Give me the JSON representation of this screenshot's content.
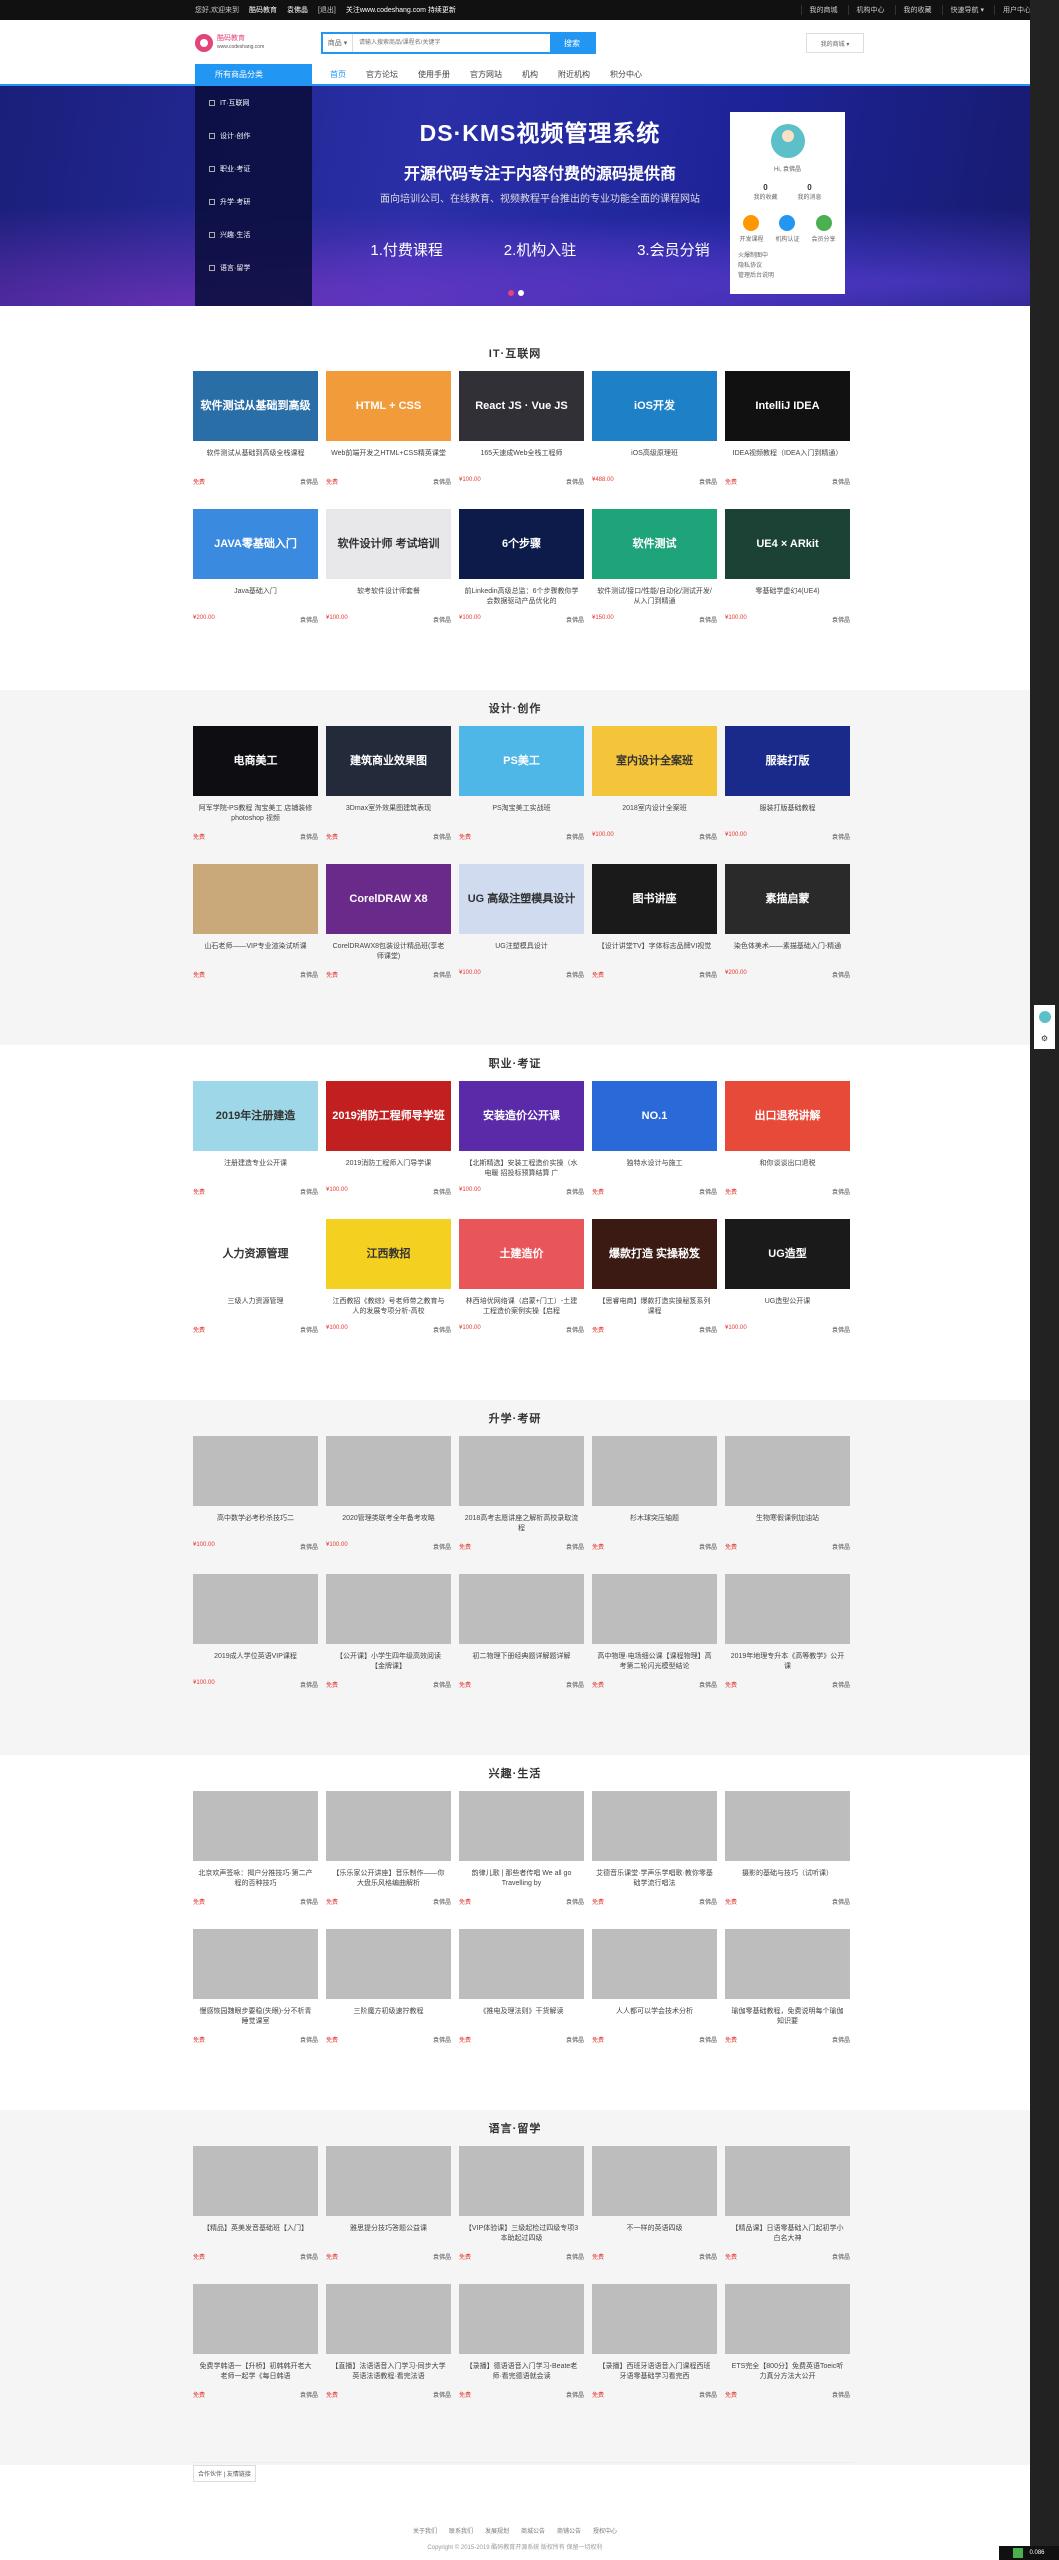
{
  "topbar": {
    "greeting": "您好,欢迎来到",
    "site": "酷码教育",
    "user": "袁佛晶",
    "login": "[退出]",
    "notice": "关注www.codeshang.com 持续更新",
    "right": [
      "我的商城",
      "机构中心",
      "我的收藏",
      "快速导航 ▾",
      "用户中心"
    ]
  },
  "header": {
    "logo_text": "酷码教育",
    "logo_sub": "www.codeshang.com",
    "search_cat": "商品 ▾",
    "search_placeholder": "请输入搜索商品/课程名/关键字",
    "search_button": "搜索",
    "myshop": "我的商城 ▾"
  },
  "nav": {
    "allcat": "所有商品分类",
    "items": [
      "首页",
      "官方论坛",
      "使用手册",
      "官方网站",
      "机构",
      "附近机构",
      "积分中心"
    ]
  },
  "banner": {
    "side": [
      "IT·互联网",
      "设计·创作",
      "职业·考证",
      "升学·考研",
      "兴趣·生活",
      "语言·留学"
    ],
    "title": "DS·KMS视频管理系统",
    "subtitle": "开源代码专注于内容付费的源码提供商",
    "desc": "面向培训公司、在线教育、视频教程平台推出的专业功能全面的课程网站",
    "items": [
      "1.付费课程",
      "2.机构入驻",
      "3.会员分销"
    ],
    "user": {
      "hi": "Hi, 袁佛晶",
      "stats": [
        {
          "n": "0",
          "l": "我的收藏"
        },
        {
          "n": "0",
          "l": "我的消息"
        }
      ],
      "icons": [
        {
          "l": "开发课程",
          "c": "#ff9800"
        },
        {
          "l": "机构认证",
          "c": "#2196f3"
        },
        {
          "l": "会员分享",
          "c": "#4caf50"
        }
      ],
      "links": [
        "火爆制图中",
        "隐私协议",
        "管理后台说明"
      ]
    }
  },
  "sections": [
    {
      "title": "IT·互联网",
      "items": [
        {
          "t": "软件测试从基础到高级全栈课程",
          "p": "免费",
          "s": "袁佛晶",
          "img": "软件测试从基础到高级",
          "c": "#2a6ea8"
        },
        {
          "t": "Web前端开发之HTML+CSS精英课堂",
          "p": "免费",
          "s": "袁佛晶",
          "img": "HTML + CSS",
          "c": "#f29b3a"
        },
        {
          "t": "165天速成Web全栈工程师",
          "p": "¥100.00",
          "s": "袁佛晶",
          "img": "React JS · Vue JS",
          "c": "#303036"
        },
        {
          "t": "iOS高级原理班",
          "p": "¥488.00",
          "s": "袁佛晶",
          "img": "iOS开发",
          "c": "#1e80c6"
        },
        {
          "t": "IDEA视频教程（IDEA入门到精通）",
          "p": "免费",
          "s": "袁佛晶",
          "img": "IntelliJ IDEA",
          "c": "#111"
        },
        {
          "t": "Java基础入门",
          "p": "¥200.00",
          "s": "袁佛晶",
          "img": "JAVA零基础入门",
          "c": "#3a8ae0"
        },
        {
          "t": "软考软件设计师套餐",
          "p": "¥100.00",
          "s": "袁佛晶",
          "img": "软件设计师 考试培训",
          "c": "#e8e8ea"
        },
        {
          "t": "前Linkedin高级总监：6个步骤教你学会数据驱动产品优化的",
          "p": "¥100.00",
          "s": "袁佛晶",
          "img": "6个步骤",
          "c": "#0d1b4a"
        },
        {
          "t": "软件测试/接口/性能/自动化/测试开发/从入门到精通",
          "p": "¥150.00",
          "s": "袁佛晶",
          "img": "软件测试",
          "c": "#1fa37a"
        },
        {
          "t": "零基础学虚幻4(UE4)",
          "p": "¥100.00",
          "s": "袁佛晶",
          "img": "UE4 × ARkit",
          "c": "#1c4235"
        }
      ]
    },
    {
      "title": "设计·创作",
      "items": [
        {
          "t": "阿军学院-PS教程 淘宝美工 店铺装修 photoshop 视频",
          "p": "免费",
          "s": "袁佛晶",
          "img": "电商美工",
          "c": "#0e0e12"
        },
        {
          "t": "3Dmax室外效果图建筑表现",
          "p": "免费",
          "s": "袁佛晶",
          "img": "建筑商业效果图",
          "c": "#232a3a"
        },
        {
          "t": "PS淘宝美工实战班",
          "p": "免费",
          "s": "袁佛晶",
          "img": "PS美工",
          "c": "#4fb6e8"
        },
        {
          "t": "2018室内设计全案班",
          "p": "¥100.00",
          "s": "袁佛晶",
          "img": "室内设计全案班",
          "c": "#f4c53a"
        },
        {
          "t": "服装打版基础教程",
          "p": "¥100.00",
          "s": "袁佛晶",
          "img": "服装打版",
          "c": "#1a2a8a"
        },
        {
          "t": "山石老师——VIP专业渲染试听课",
          "p": "免费",
          "s": "袁佛晶",
          "img": "",
          "c": "#c9a97a"
        },
        {
          "t": "CorelDRAWX8包装设计精品班(享老师课堂)",
          "p": "免费",
          "s": "袁佛晶",
          "img": "CorelDRAW X8",
          "c": "#6a2a8a"
        },
        {
          "t": "UG注塑模具设计",
          "p": "¥100.00",
          "s": "袁佛晶",
          "img": "UG 高级注塑模具设计",
          "c": "#d0dbef"
        },
        {
          "t": "【设计讲堂TV】字体标志品牌VI视觉",
          "p": "免费",
          "s": "袁佛晶",
          "img": "图书讲座",
          "c": "#1a1a1a"
        },
        {
          "t": "染色体美术——素描基础入门-精通",
          "p": "¥200.00",
          "s": "袁佛晶",
          "img": "素描启蒙",
          "c": "#2a2a2a"
        }
      ]
    },
    {
      "title": "职业·考证",
      "items": [
        {
          "t": "注册建造专业公开课",
          "p": "免费",
          "s": "袁佛晶",
          "img": "2019年注册建造",
          "c": "#9ed8e8"
        },
        {
          "t": "2019消防工程师入门导学课",
          "p": "¥100.00",
          "s": "袁佛晶",
          "img": "2019消防工程师导学班",
          "c": "#c22020"
        },
        {
          "t": "【北斯精选】安装工程造价实操（水电暖 招投标预算结算 广",
          "p": "¥100.00",
          "s": "袁佛晶",
          "img": "安装造价公开课",
          "c": "#5a2aa8"
        },
        {
          "t": "独特水设计与施工",
          "p": "免费",
          "s": "袁佛晶",
          "img": "NO.1",
          "c": "#2a6ad8"
        },
        {
          "t": "和你谈谈出口退税",
          "p": "免费",
          "s": "袁佛晶",
          "img": "出口退税讲解",
          "c": "#e84a3a"
        },
        {
          "t": "三级人力资源管理",
          "p": "免费",
          "s": "袁佛晶",
          "img": "人力资源管理",
          "c": "#ffffff"
        },
        {
          "t": "江西教招《教综》号老师带之教育与人的发展专项分析-高校",
          "p": "¥100.00",
          "s": "袁佛晶",
          "img": "江西教招",
          "c": "#f4d020"
        },
        {
          "t": "林西培优网络课（启蒙+门工）-土建工程造价案例实操【启程",
          "p": "¥100.00",
          "s": "袁佛晶",
          "img": "土建造价",
          "c": "#e8565a"
        },
        {
          "t": "【思睿电商】爆款打造实操秘笈系列课程",
          "p": "免费",
          "s": "袁佛晶",
          "img": "爆款打造 实操秘笈",
          "c": "#3a1a12"
        },
        {
          "t": "UG造型公开课",
          "p": "¥100.00",
          "s": "袁佛晶",
          "img": "UG造型",
          "c": "#1a1a1a"
        }
      ]
    },
    {
      "title": "升学·考研",
      "items": [
        {
          "t": "高中数学必考秒杀技巧二",
          "p": "¥100.00",
          "s": "袁佛晶"
        },
        {
          "t": "2020管理类联考全年备考攻略",
          "p": "¥100.00",
          "s": "袁佛晶"
        },
        {
          "t": "2018高考志愿讲座之解析高校录取流程",
          "p": "免费",
          "s": "袁佛晶"
        },
        {
          "t": "杉木球突压轴题",
          "p": "免费",
          "s": "袁佛晶"
        },
        {
          "t": "生物寒假课例加油站",
          "p": "免费",
          "s": "袁佛晶"
        },
        {
          "t": "2019成人学位英语VIP课程",
          "p": "¥100.00",
          "s": "袁佛晶"
        },
        {
          "t": "【公开课】小学生四年级高效阅读【金牌课】",
          "p": "免费",
          "s": "袁佛晶"
        },
        {
          "t": "初二物理下册经典题详解题详解",
          "p": "免费",
          "s": "袁佛晶"
        },
        {
          "t": "高中物理·电场细公课【课程物理】高考第二轮闪光模型结论",
          "p": "免费",
          "s": "袁佛晶"
        },
        {
          "t": "2019年地理专升本《高等教学》公开课",
          "p": "免费",
          "s": "袁佛晶"
        }
      ]
    },
    {
      "title": "兴趣·生活",
      "items": [
        {
          "t": "北京欢声签咏：揭户分推技巧·第二产程的否种技巧",
          "p": "免费",
          "s": "袁佛晶"
        },
        {
          "t": "【乐乐家公开讲座】音乐制作——你大盘乐风格编曲解析",
          "p": "免费",
          "s": "袁佛晶"
        },
        {
          "t": "韵律儿歌 | 那些者传唱 We all go Travelling by",
          "p": "免费",
          "s": "袁佛晶"
        },
        {
          "t": "艾德音乐课堂·学声乐学唱歌·教你零基础学流行唱法",
          "p": "免费",
          "s": "袁佛晶"
        },
        {
          "t": "摄影的基础与技巧（试听课）",
          "p": "免费",
          "s": "袁佛晶"
        },
        {
          "t": "慢感恢园魏眼步要稳(失眼)-分不析青睡觉课室",
          "p": "免费",
          "s": "袁佛晶"
        },
        {
          "t": "三阶魔方初级速拧教程",
          "p": "免费",
          "s": "袁佛晶"
        },
        {
          "t": "《推电及理法则》干货解读",
          "p": "免费",
          "s": "袁佛晶"
        },
        {
          "t": "人人都可以学会技术分析",
          "p": "免费",
          "s": "袁佛晶"
        },
        {
          "t": "瑜伽零基础教程，免费说明每个瑜伽知识要",
          "p": "免费",
          "s": "袁佛晶"
        }
      ]
    },
    {
      "title": "语言·留学",
      "items": [
        {
          "t": "【精品】英美发音基础班【入门】",
          "p": "免费",
          "s": "袁佛晶"
        },
        {
          "t": "雅思提分技巧答题公益课",
          "p": "免费",
          "s": "袁佛晶"
        },
        {
          "t": "【VIP体验课】三级起检过四级专项3本助起过四级",
          "p": "免费",
          "s": "袁佛晶"
        },
        {
          "t": "不一样的英语四级",
          "p": "免费",
          "s": "袁佛晶"
        },
        {
          "t": "【精品课】日语零基础入门起初学小白名大神",
          "p": "免费",
          "s": "袁佛晶"
        },
        {
          "t": "免费学韩语一【升桥】初韩韩开老大老师一起学《每日韩语",
          "p": "免费",
          "s": "袁佛晶"
        },
        {
          "t": "【直播】法语语音入门学习-同步大学英语法语教程·看完法语",
          "p": "免费",
          "s": "袁佛晶"
        },
        {
          "t": "【录播】德语语音入门学习-Beate老师·看完德语就会读",
          "p": "免费",
          "s": "袁佛晶"
        },
        {
          "t": "【录播】西班牙语语音入门课程西班牙语零基础学习看完西",
          "p": "免费",
          "s": "袁佛晶"
        },
        {
          "t": "ETS完全【800分】免费英语Toeic听力真分方法大公开",
          "p": "免费",
          "s": "袁佛晶"
        }
      ]
    }
  ],
  "footer": {
    "friend": "合作伙伴 | 友情链接",
    "links": [
      "关于我们",
      "联系我们",
      "发展规划",
      "商城公告",
      "商铺公告",
      "授权中心"
    ],
    "copy": "Copyright © 2015-2019 酷码教育开源系统 版权所有 保留一切权利"
  },
  "corner": "0.086"
}
